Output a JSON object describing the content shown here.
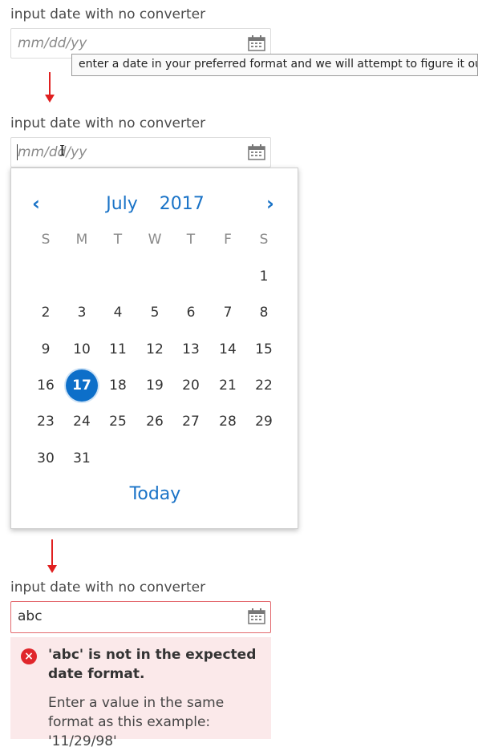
{
  "section1": {
    "label": "input date with no converter",
    "placeholder": "mm/dd/yy",
    "tooltip": "enter a date in your preferred format and we will attempt to figure it out"
  },
  "section2": {
    "label": "input date with no converter",
    "placeholder": "mm/dd/yy",
    "calendar": {
      "month": "July",
      "year": "2017",
      "prev_icon": "‹",
      "next_icon": "›",
      "weekdays": [
        "S",
        "M",
        "T",
        "W",
        "T",
        "F",
        "S"
      ],
      "weeks": [
        [
          "",
          "",
          "",
          "",
          "",
          "",
          "1"
        ],
        [
          "2",
          "3",
          "4",
          "5",
          "6",
          "7",
          "8"
        ],
        [
          "9",
          "10",
          "11",
          "12",
          "13",
          "14",
          "15"
        ],
        [
          "16",
          "17",
          "18",
          "19",
          "20",
          "21",
          "22"
        ],
        [
          "23",
          "24",
          "25",
          "26",
          "27",
          "28",
          "29"
        ],
        [
          "30",
          "31",
          "",
          "",
          "",
          "",
          ""
        ]
      ],
      "selected_day": "17",
      "today_label": "Today"
    }
  },
  "section3": {
    "label": "input date with no converter",
    "value": "abc",
    "error_icon": "×",
    "error_title": "'abc' is not in the expected date format.",
    "error_detail": "Enter a value in the same format as this example: '11/29/98'"
  },
  "colors": {
    "accent": "#1a73c7",
    "selected": "#0d6fc9",
    "error": "#e0262b",
    "error_bg": "#fbe9ea",
    "arrow": "#e02020"
  }
}
